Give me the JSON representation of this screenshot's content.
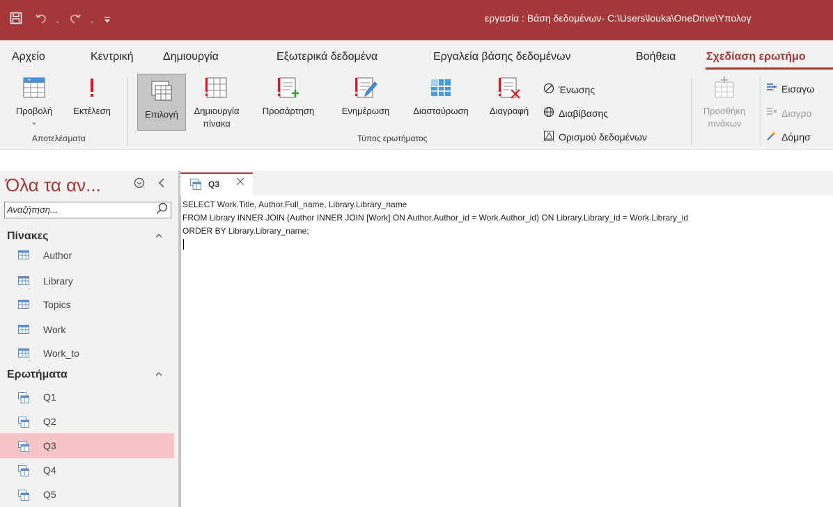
{
  "window": {
    "title": "εργασία : Βάση δεδομένων- C:\\Users\\louka\\OneDrive\\Υπολογ",
    "accent_color": "#a4373a"
  },
  "quick_access": [
    "save-icon",
    "undo-icon",
    "redo-icon",
    "customize-icon"
  ],
  "tabs": [
    {
      "label": "Αρχείο"
    },
    {
      "label": "Κεντρική"
    },
    {
      "label": "Δημιουργία"
    },
    {
      "label": "Εξωτερικά δεδομένα"
    },
    {
      "label": "Εργαλεία βάσης δεδομένων"
    },
    {
      "label": "Βοήθεια"
    },
    {
      "label": "Σχεδίαση ερωτήμο"
    }
  ],
  "ribbon": {
    "results": {
      "view_label": "Προβολή",
      "run_label": "Εκτέλεση",
      "group_label": "Αποτελέσματα"
    },
    "query_type": {
      "select_label": "Επιλογή",
      "make_table_line1": "Δημιουργία",
      "make_table_line2": "πίνακα",
      "append_label": "Προσάρτηση",
      "update_label": "Ενημέρωση",
      "crosstab_label": "Διασταύρωση",
      "delete_label": "Διαγραφή",
      "union_label": "Ένωσης",
      "passthrough_label": "Διαβίβασης",
      "data_definition_label": "Ορισμού δεδομένων",
      "group_label": "Τύπος ερωτήματος"
    },
    "query_setup": {
      "add_tables_line1": "Προσθήκη",
      "add_tables_line2": "πινάκων",
      "insert_rows_label": "Εισαγω",
      "delete_rows_label": "Διαγρα",
      "builder_label": "Δόμησ"
    }
  },
  "nav": {
    "title": "Όλα τα αν...",
    "search_placeholder": "Αναζήτηση...",
    "tables_header": "Πίνακες",
    "tables": [
      {
        "label": "Author"
      },
      {
        "label": "Library"
      },
      {
        "label": "Topics"
      },
      {
        "label": "Work"
      },
      {
        "label": "Work_to"
      }
    ],
    "queries_header": "Ερωτήματα",
    "queries": [
      {
        "label": "Q1"
      },
      {
        "label": "Q2"
      },
      {
        "label": "Q3"
      },
      {
        "label": "Q4"
      },
      {
        "label": "Q5"
      }
    ],
    "selected_query": "Q3"
  },
  "document": {
    "tab_label": "Q3",
    "sql_lines": [
      "SELECT Work.Title, Author.Full_name, Library.Library_name",
      "FROM Library INNER JOIN (Author INNER JOIN [Work] ON Author.Author_id = Work.Author_id) ON Library.Library_id = Work.Library_id",
      "ORDER BY Library.Library_name;"
    ]
  }
}
